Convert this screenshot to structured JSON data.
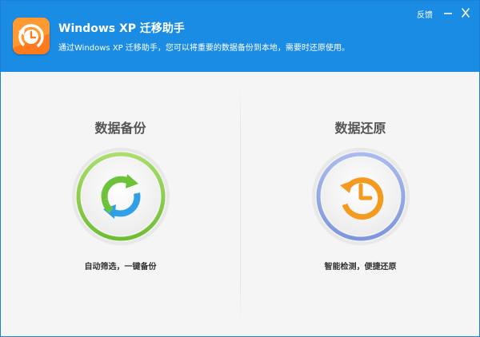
{
  "header": {
    "title": "Windows XP 迁移助手",
    "subtitle": "通过Windows XP 迁移助手，您可以将重要的数据备份到本地，需要时还原使用。",
    "feedback": "反馈",
    "icons": {
      "logo": "clock-arrow-icon",
      "minimize": "minimize-icon",
      "close": "close-icon"
    }
  },
  "backup": {
    "title": "数据备份",
    "description": "自动筛选，一键备份",
    "icon": "refresh-arrows-icon",
    "ring_color": "#8dd04a"
  },
  "restore": {
    "title": "数据还原",
    "description": "智能检测，便捷还原",
    "icon": "clock-restore-icon",
    "ring_color": "#8fa8e6"
  },
  "colors": {
    "header_bg": "#1a8ce4",
    "accent_orange": "#f39a1f",
    "accent_green": "#6cc33a",
    "accent_blue": "#2f9fe6"
  }
}
